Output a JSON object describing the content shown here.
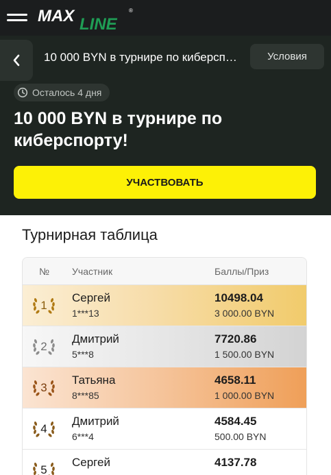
{
  "header": {
    "logo_text": "MAXLINE",
    "colors": {
      "bar": "#1b1d1e",
      "logo_white": "#ffffff",
      "logo_green": "#1f9d55"
    }
  },
  "tournament": {
    "short_title": "10 000 BYN в турнире по киберсп…",
    "conditions_label": "Условия",
    "time_left": "Осталось 4 дня",
    "title": "10 000 BYN в турнире по киберспорту!",
    "participate_label": "УЧАСТВОВАТЬ",
    "colors": {
      "hero_bg": "#1e2521",
      "button": "#fdf106"
    }
  },
  "leaderboard": {
    "title": "Турнирная таблица",
    "columns": [
      "№",
      "Участник",
      "Баллы/Приз"
    ],
    "rows": [
      {
        "place": "1",
        "name": "Сергей",
        "id": "1***13",
        "score": "10498.04",
        "prize": "3 000.00 BYN",
        "medal": "gold"
      },
      {
        "place": "2",
        "name": "Дмитрий",
        "id": "5***8",
        "score": "7720.86",
        "prize": "1 500.00 BYN",
        "medal": "silver"
      },
      {
        "place": "3",
        "name": "Татьяна",
        "id": "8***85",
        "score": "4658.11",
        "prize": "1 000.00 BYN",
        "medal": "bronze"
      },
      {
        "place": "4",
        "name": "Дмитрий",
        "id": "6***4",
        "score": "4584.45",
        "prize": "500.00 BYN",
        "medal": "plain"
      },
      {
        "place": "5",
        "name": "Сергей",
        "id": "",
        "score": "4137.78",
        "prize": "",
        "medal": "plain"
      }
    ]
  }
}
